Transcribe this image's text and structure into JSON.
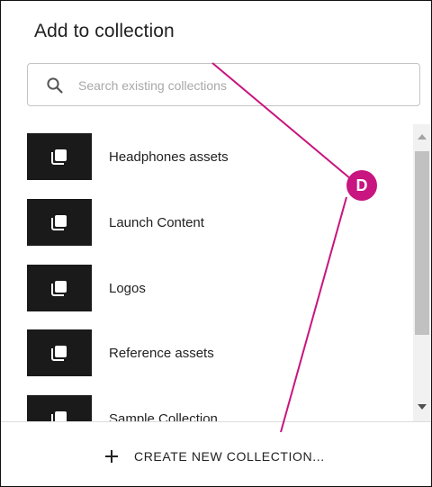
{
  "dialog": {
    "title": "Add to collection",
    "search": {
      "placeholder": "Search existing collections",
      "value": ""
    },
    "collections": [
      {
        "label": "Headphones assets"
      },
      {
        "label": "Launch Content"
      },
      {
        "label": "Logos"
      },
      {
        "label": "Reference assets"
      },
      {
        "label": "Sample Collection"
      }
    ],
    "create_button_label": "CREATE NEW COLLECTION..."
  },
  "annotation": {
    "callout_label": "D",
    "callout_color": "#c8157f"
  },
  "icons": {
    "search": "search-icon",
    "collection": "collection-stack-icon",
    "plus": "plus-icon",
    "scroll_up": "scroll-up-arrow-icon",
    "scroll_down": "scroll-down-arrow-icon"
  },
  "colors": {
    "thumbnail_bg": "#1a1a1a",
    "border": "#c4c4c4",
    "text": "#222222"
  }
}
